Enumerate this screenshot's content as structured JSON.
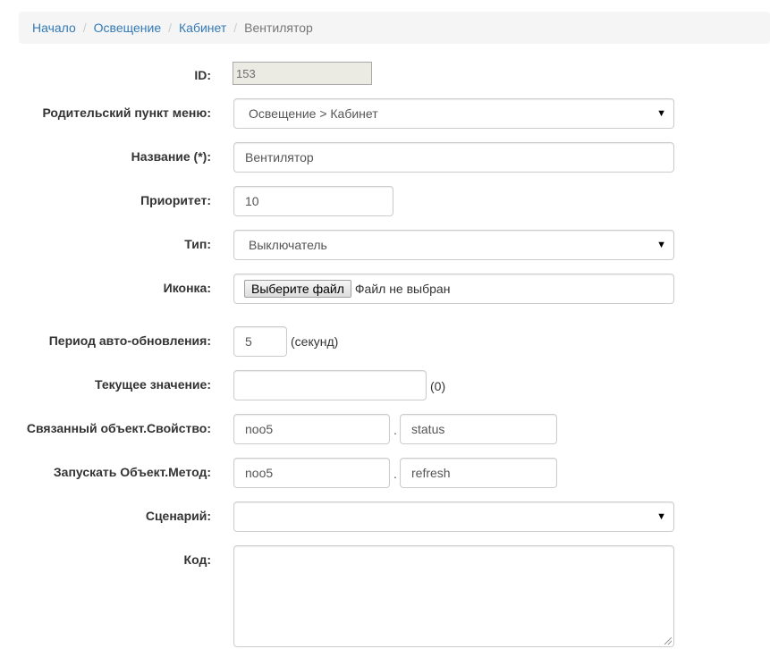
{
  "breadcrumb": {
    "items": [
      "Начало",
      "Освещение",
      "Кабинет"
    ],
    "active": "Вентилятор",
    "separator": "/"
  },
  "form": {
    "id": {
      "label": "ID:",
      "value": "153"
    },
    "parent": {
      "label": "Родительский пункт меню:",
      "value": "Освещение > Кабинет"
    },
    "title": {
      "label": "Название (*):",
      "value": "Вентилятор"
    },
    "priority": {
      "label": "Приоритет:",
      "value": "10"
    },
    "type": {
      "label": "Тип:",
      "value": "Выключатель"
    },
    "icon": {
      "label": "Иконка:",
      "button": "Выберите файл",
      "status": "Файл не выбран"
    },
    "refresh": {
      "label": "Период авто-обновления:",
      "value": "5",
      "suffix": "(секунд)"
    },
    "current": {
      "label": "Текущее значение:",
      "value": "",
      "suffix": "(0)"
    },
    "linked": {
      "label": "Связанный объект.Свойство:",
      "object": "noo5",
      "property": "status",
      "dot": "."
    },
    "run": {
      "label": "Запускать Объект.Метод:",
      "object": "noo5",
      "method": "refresh",
      "dot": "."
    },
    "script": {
      "label": "Сценарий:",
      "value": ""
    },
    "code": {
      "label": "Код:",
      "value": ""
    }
  },
  "icons": {
    "caret": "dropdown-caret-icon"
  },
  "colors": {
    "link": "#337ab7",
    "breadcrumb_bg": "#f5f5f5",
    "border": "#cccccc"
  }
}
